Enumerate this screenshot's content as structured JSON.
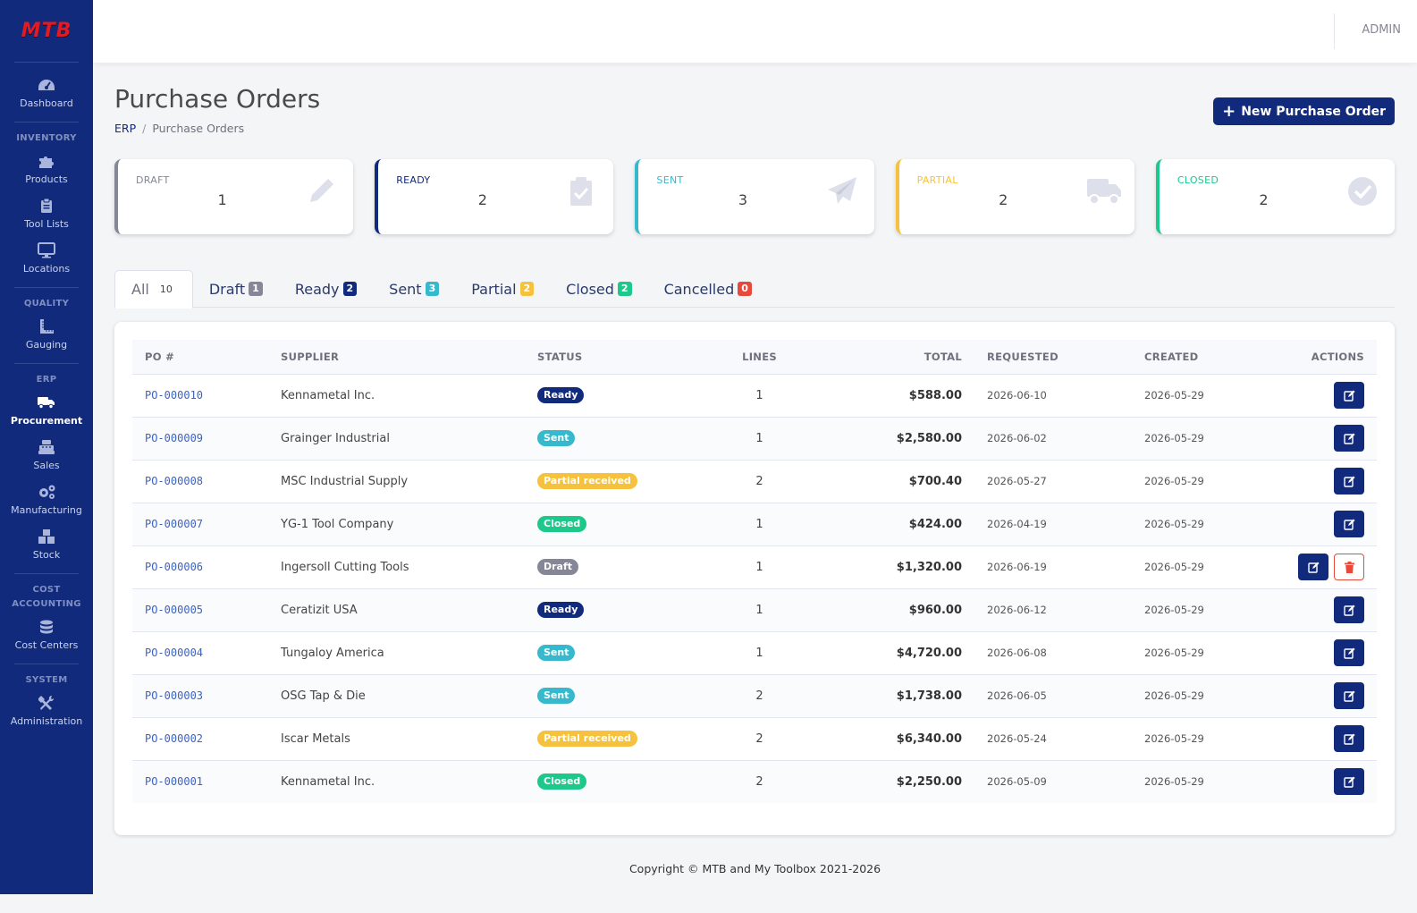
{
  "brand": {
    "logo_text": "MTB"
  },
  "sidebar": {
    "items": [
      {
        "label": "Dashboard",
        "icon": "gauge-icon"
      },
      {
        "section": "INVENTORY"
      },
      {
        "label": "Products",
        "icon": "puzzle-icon"
      },
      {
        "label": "Tool Lists",
        "icon": "clipboard-icon"
      },
      {
        "label": "Locations",
        "icon": "monitor-icon"
      },
      {
        "section": "QUALITY"
      },
      {
        "label": "Gauging",
        "icon": "ruler-icon"
      },
      {
        "section": "ERP"
      },
      {
        "label": "Procurement",
        "icon": "truck-icon",
        "active": true
      },
      {
        "label": "Sales",
        "icon": "cash-register-icon"
      },
      {
        "label": "Manufacturing",
        "icon": "cogs-icon"
      },
      {
        "label": "Stock",
        "icon": "boxes-icon"
      },
      {
        "section": "COST ACCOUNTING"
      },
      {
        "label": "Cost Centers",
        "icon": "coins-icon"
      },
      {
        "section": "SYSTEM"
      },
      {
        "label": "Administration",
        "icon": "tools-icon"
      }
    ]
  },
  "topbar": {
    "user": "ADMIN"
  },
  "page": {
    "title": "Purchase Orders",
    "breadcrumb_root": "ERP",
    "breadcrumb_sep": "/",
    "breadcrumb_current": "Purchase Orders",
    "new_button": "New Purchase Order"
  },
  "cards": [
    {
      "label": "DRAFT",
      "value": "1",
      "icon": "pencil-icon",
      "color": "#858796"
    },
    {
      "label": "READY",
      "value": "2",
      "icon": "clipboard-check-icon",
      "color": "#112a7c"
    },
    {
      "label": "SENT",
      "value": "3",
      "icon": "paper-plane-icon",
      "color": "#36b9cc"
    },
    {
      "label": "PARTIAL",
      "value": "2",
      "icon": "truck-icon",
      "color": "#f6c23e"
    },
    {
      "label": "CLOSED",
      "value": "2",
      "icon": "check-circle-icon",
      "color": "#1cc88a"
    }
  ],
  "tabs": [
    {
      "label": "All",
      "count": "10",
      "active": true
    },
    {
      "label": "Draft",
      "count": "1",
      "color": "#858796"
    },
    {
      "label": "Ready",
      "count": "2",
      "color": "#112a7c"
    },
    {
      "label": "Sent",
      "count": "3",
      "color": "#36b9cc"
    },
    {
      "label": "Partial",
      "count": "2",
      "color": "#f6c23e"
    },
    {
      "label": "Closed",
      "count": "2",
      "color": "#1cc88a"
    },
    {
      "label": "Cancelled",
      "count": "0",
      "color": "#e74a3b"
    }
  ],
  "table": {
    "headers": [
      "PO #",
      "SUPPLIER",
      "STATUS",
      "LINES",
      "TOTAL",
      "REQUESTED",
      "CREATED",
      "ACTIONS"
    ],
    "rows": [
      {
        "po": "PO-000010",
        "supplier": "Kennametal Inc.",
        "status": "Ready",
        "status_color": "#112a7c",
        "lines": "1",
        "total": "$588.00",
        "requested": "2026-06-10",
        "created": "2026-05-29",
        "deletable": false
      },
      {
        "po": "PO-000009",
        "supplier": "Grainger Industrial",
        "status": "Sent",
        "status_color": "#36b9cc",
        "lines": "1",
        "total": "$2,580.00",
        "requested": "2026-06-02",
        "created": "2026-05-29",
        "deletable": false
      },
      {
        "po": "PO-000008",
        "supplier": "MSC Industrial Supply",
        "status": "Partial received",
        "status_color": "#f6c23e",
        "lines": "2",
        "total": "$700.40",
        "requested": "2026-05-27",
        "created": "2026-05-29",
        "deletable": false
      },
      {
        "po": "PO-000007",
        "supplier": "YG-1 Tool Company",
        "status": "Closed",
        "status_color": "#1cc88a",
        "lines": "1",
        "total": "$424.00",
        "requested": "2026-04-19",
        "created": "2026-05-29",
        "deletable": false
      },
      {
        "po": "PO-000006",
        "supplier": "Ingersoll Cutting Tools",
        "status": "Draft",
        "status_color": "#858796",
        "lines": "1",
        "total": "$1,320.00",
        "requested": "2026-06-19",
        "created": "2026-05-29",
        "deletable": true
      },
      {
        "po": "PO-000005",
        "supplier": "Ceratizit USA",
        "status": "Ready",
        "status_color": "#112a7c",
        "lines": "1",
        "total": "$960.00",
        "requested": "2026-06-12",
        "created": "2026-05-29",
        "deletable": false
      },
      {
        "po": "PO-000004",
        "supplier": "Tungaloy America",
        "status": "Sent",
        "status_color": "#36b9cc",
        "lines": "1",
        "total": "$4,720.00",
        "requested": "2026-06-08",
        "created": "2026-05-29",
        "deletable": false
      },
      {
        "po": "PO-000003",
        "supplier": "OSG Tap & Die",
        "status": "Sent",
        "status_color": "#36b9cc",
        "lines": "2",
        "total": "$1,738.00",
        "requested": "2026-06-05",
        "created": "2026-05-29",
        "deletable": false
      },
      {
        "po": "PO-000002",
        "supplier": "Iscar Metals",
        "status": "Partial received",
        "status_color": "#f6c23e",
        "lines": "2",
        "total": "$6,340.00",
        "requested": "2026-05-24",
        "created": "2026-05-29",
        "deletable": false
      },
      {
        "po": "PO-000001",
        "supplier": "Kennametal Inc.",
        "status": "Closed",
        "status_color": "#1cc88a",
        "lines": "2",
        "total": "$2,250.00",
        "requested": "2026-05-09",
        "created": "2026-05-29",
        "deletable": false
      }
    ]
  },
  "footer": {
    "text": "Copyright © MTB and My Toolbox 2021-2026"
  }
}
